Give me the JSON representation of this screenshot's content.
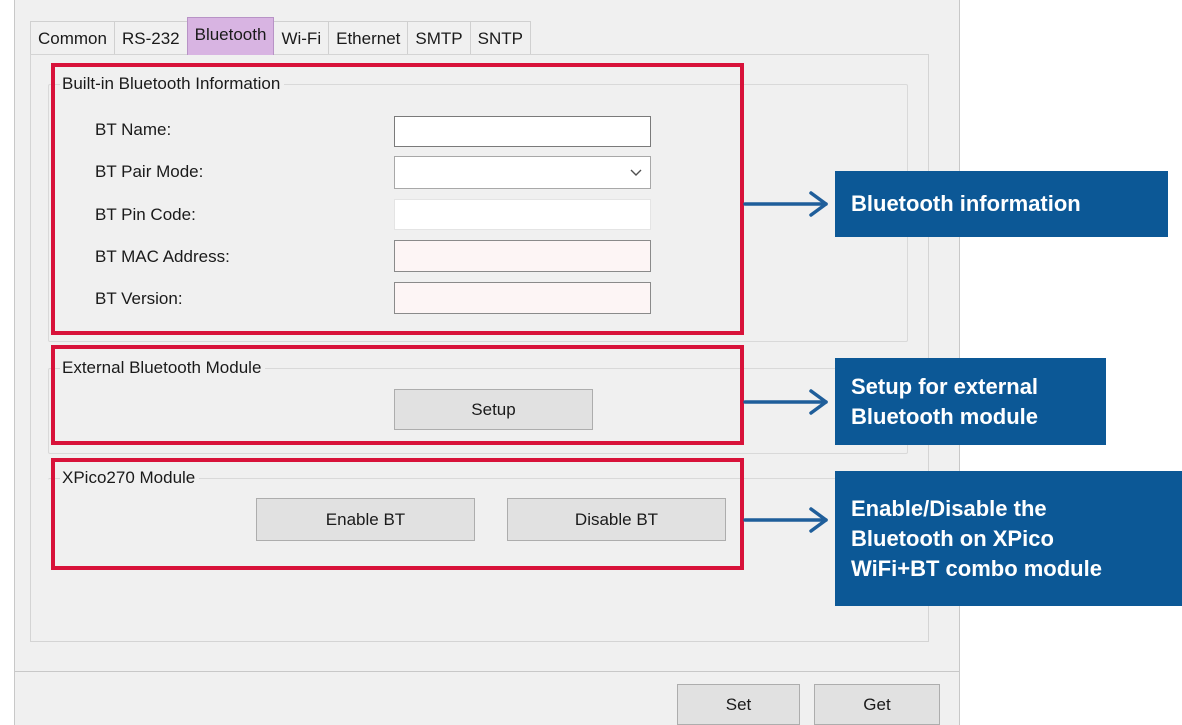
{
  "tabs": [
    {
      "label": "Common",
      "active": false
    },
    {
      "label": "RS-232",
      "active": false
    },
    {
      "label": "Bluetooth",
      "active": true
    },
    {
      "label": "Wi-Fi",
      "active": false
    },
    {
      "label": "Ethernet",
      "active": false
    },
    {
      "label": "SMTP",
      "active": false
    },
    {
      "label": "SNTP",
      "active": false
    }
  ],
  "builtin": {
    "title": "Built-in Bluetooth Information",
    "bt_name_label": "BT Name:",
    "bt_name_value": "",
    "bt_pair_mode_label": "BT Pair Mode:",
    "bt_pair_mode_value": "",
    "bt_pin_code_label": "BT Pin Code:",
    "bt_pin_code_value": "",
    "bt_mac_label": "BT MAC Address:",
    "bt_mac_value": "",
    "bt_version_label": "BT Version:",
    "bt_version_value": ""
  },
  "external": {
    "title": "External Bluetooth Module",
    "setup_label": "Setup"
  },
  "xpico": {
    "title": "XPico270 Module",
    "enable_label": "Enable BT",
    "disable_label": "Disable BT"
  },
  "footer": {
    "set_label": "Set",
    "get_label": "Get"
  },
  "callouts": {
    "info": "Bluetooth information",
    "external": "Setup for external\nBluetooth module",
    "xpico": "Enable/Disable the\nBluetooth on XPico\nWiFi+BT combo module"
  },
  "icons": {
    "dropdown": "chevron-down-icon",
    "arrow": "arrow-right-icon"
  },
  "colors": {
    "active_tab": "#d8b4e2",
    "highlight": "#d8123a",
    "callout": "#0c5896",
    "arrow": "#1f5e9a"
  }
}
